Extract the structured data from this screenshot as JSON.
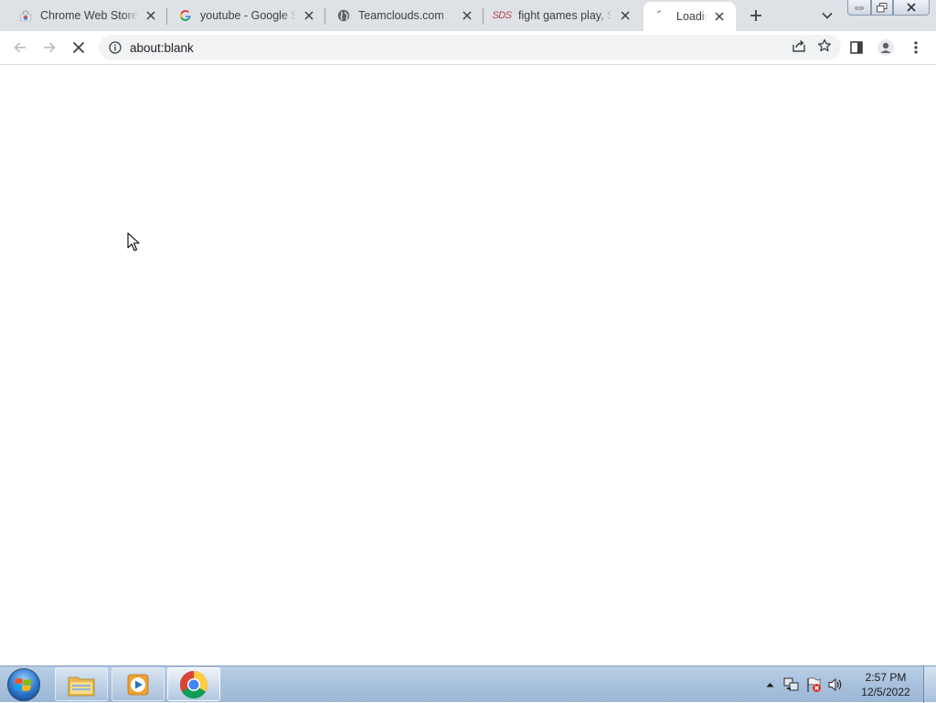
{
  "browser": {
    "tabs": [
      {
        "title": "Chrome Web Store",
        "favicon": "chrome-web-store-icon",
        "active": false
      },
      {
        "title": "youtube - Google Search",
        "favicon": "google-g-icon",
        "active": false
      },
      {
        "title": "Teamclouds.com",
        "favicon": "globe-icon",
        "active": false
      },
      {
        "title": "fight games play, Su",
        "favicon": "sds-icon",
        "favicon_text": "SDS",
        "active": false
      },
      {
        "title": "Loading",
        "favicon": "loading-icon",
        "active": true
      }
    ],
    "address": {
      "url": "about:blank"
    }
  },
  "taskbar": {
    "apps": [
      {
        "name": "windows-explorer",
        "icon": "folder-icon"
      },
      {
        "name": "media-player",
        "icon": "media-player-icon"
      },
      {
        "name": "google-chrome",
        "icon": "chrome-icon",
        "active": true
      }
    ],
    "clock": {
      "time": "2:57 PM",
      "date": "12/5/2022"
    }
  },
  "colors": {
    "tab_strip": "#dee1e6",
    "omnibox": "#f1f3f4",
    "taskbar": "#a9c2dd"
  }
}
